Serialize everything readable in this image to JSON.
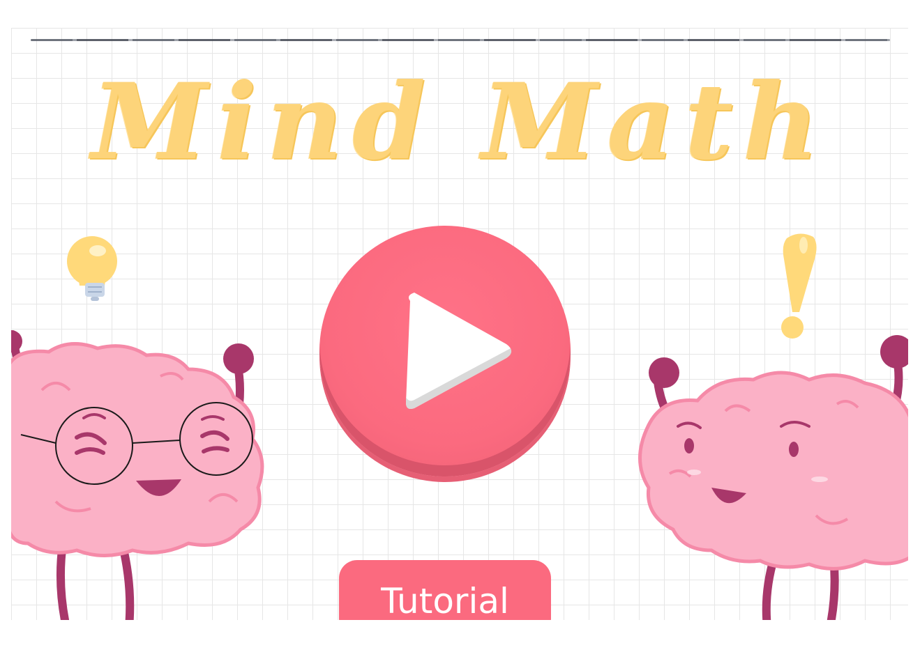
{
  "title": "Mind Math",
  "buttons": {
    "play_icon": "play-icon",
    "tutorial_label": "Tutorial"
  },
  "colors": {
    "title": "#fdd47a",
    "button": "#fb6a7f",
    "brain": "#fbb1c6",
    "brain_outline": "#f58aa8",
    "limbs": "#a8376a",
    "bulb": "#ffd97a",
    "exclamation": "#ffd97a"
  },
  "icons": [
    "lightbulb-icon",
    "exclamation-icon",
    "play-icon"
  ]
}
